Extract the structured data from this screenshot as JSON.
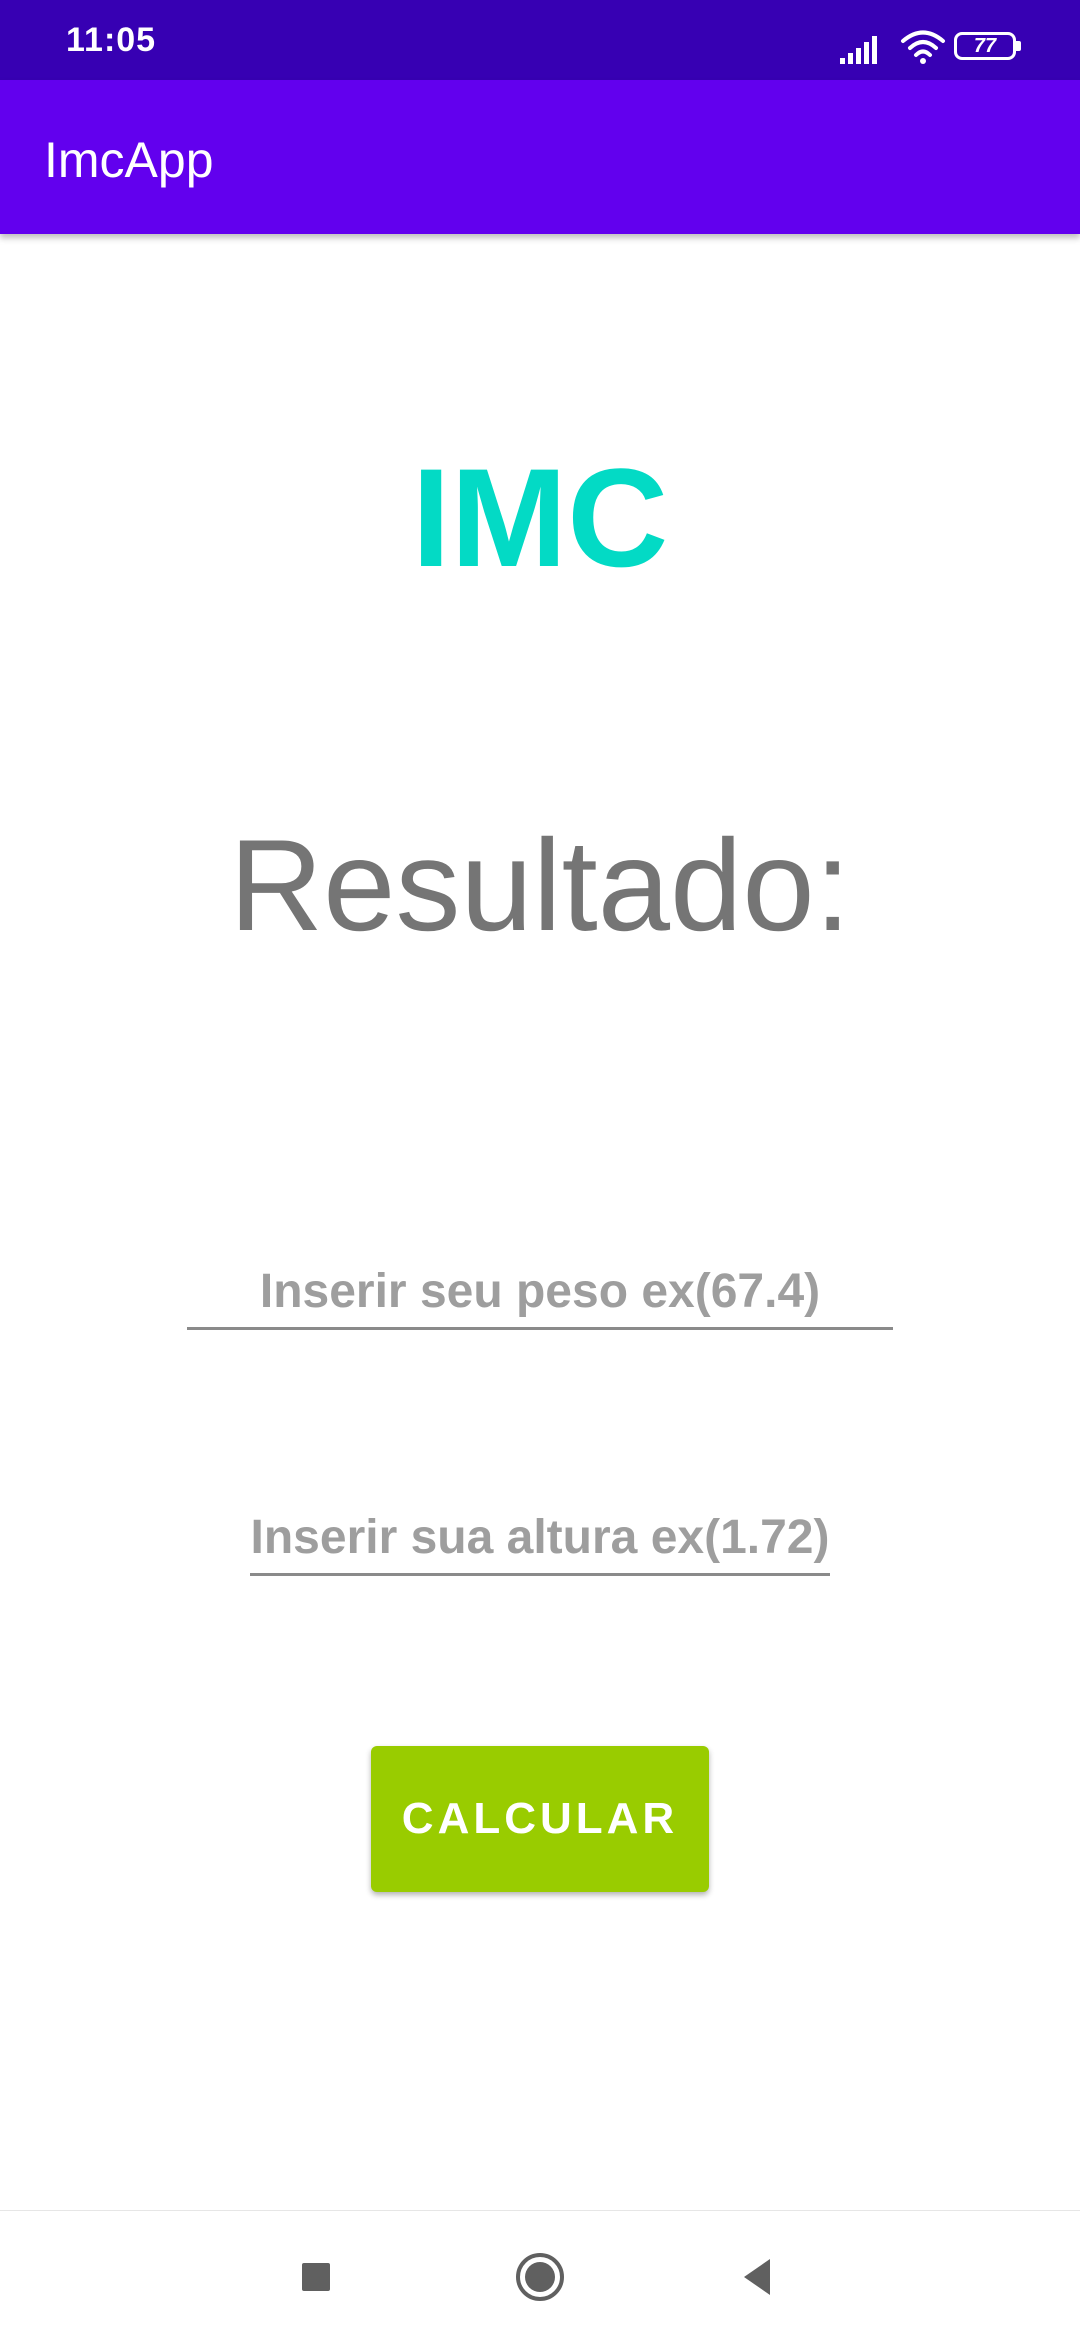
{
  "status_bar": {
    "time": "11:05",
    "battery_level": "77",
    "icons": [
      "signal-icon",
      "wifi-icon",
      "battery-icon"
    ]
  },
  "app_bar": {
    "title": "ImcApp",
    "color": "#6200EE"
  },
  "main": {
    "heading": "IMC",
    "heading_color": "#03DAC5",
    "result_label": "Resultado:",
    "weight_input": {
      "value": "",
      "placeholder": "Inserir seu peso ex(67.4)"
    },
    "height_input": {
      "value": "",
      "placeholder": "Inserir sua altura ex(1.72)"
    },
    "calculate_button": {
      "label": "CALCULAR",
      "color": "#99CC00"
    }
  },
  "nav_bar": {
    "buttons": [
      "recents-button",
      "home-button",
      "back-button"
    ]
  }
}
